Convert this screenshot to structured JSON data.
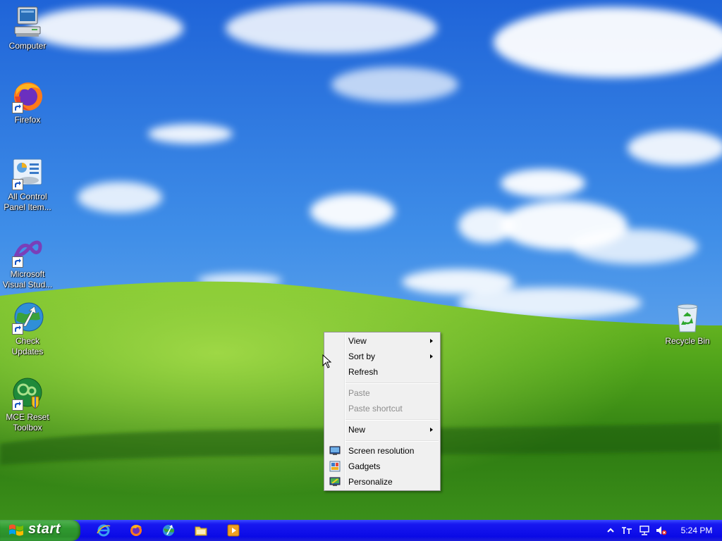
{
  "desktop": {
    "icons": [
      {
        "label_lines": [
          "Computer"
        ]
      },
      {
        "label_lines": [
          "Firefox"
        ]
      },
      {
        "label_lines": [
          "All Control",
          "Panel Item..."
        ]
      },
      {
        "label_lines": [
          "Microsoft",
          "Visual Stud..."
        ]
      },
      {
        "label_lines": [
          "Check",
          "Updates"
        ]
      },
      {
        "label_lines": [
          "MCE Reset",
          "Toolbox"
        ]
      },
      {
        "label_lines": [
          "Recycle Bin"
        ]
      }
    ]
  },
  "context_menu": {
    "view": "View",
    "sort_by": "Sort by",
    "refresh": "Refresh",
    "paste": "Paste",
    "paste_shortcut": "Paste shortcut",
    "new": "New",
    "screen_resolution": "Screen resolution",
    "gadgets": "Gadgets",
    "personalize": "Personalize"
  },
  "taskbar": {
    "start_label": "start",
    "clock": "5:24 PM"
  },
  "colors": {
    "taskbar": "#0a0ae6",
    "start_button": "#2f9a2f",
    "menu_background": "#f0f0f0",
    "disabled_text": "#8d8d8d"
  }
}
